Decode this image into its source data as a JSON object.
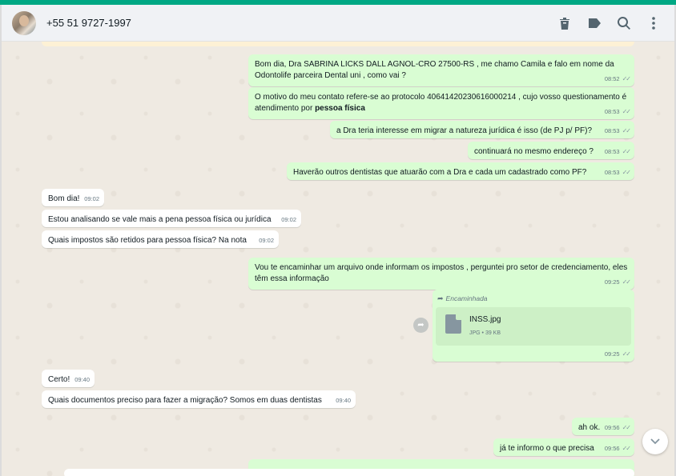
{
  "header": {
    "contact_name": "+55 51 9727-1997",
    "icons": [
      "trash-icon",
      "label-icon",
      "search-icon",
      "menu-icon"
    ]
  },
  "messages": [
    {
      "dir": "out",
      "text": "Bom dia, Dra  SABRINA LICKS DALL AGNOL-CRO  27500-RS , me chamo Camila e falo em nome da Odontolife parceira Dental uni , como vai ?",
      "time": "08:52"
    },
    {
      "dir": "out",
      "text": "O motivo do meu contato refere-se ao protocolo 40641420230616000214 , cujo vosso questionamento é atendimento por ",
      "bold": "pessoa física",
      "time": "08:53"
    },
    {
      "dir": "out",
      "text": "a Dra teria interesse em migrar a natureza jurídica é isso (de PJ p/ PF)?",
      "time": "08:53"
    },
    {
      "dir": "out",
      "text": "continuará no mesmo endereço ?",
      "time": "08:53"
    },
    {
      "dir": "out",
      "text": "Haverão outros dentistas que atuarão com a Dra e cada um cadastrado como PF?",
      "time": "08:53"
    },
    {
      "dir": "in",
      "text": "Bom dia!",
      "time": "09:02"
    },
    {
      "dir": "in",
      "text": "Estou analisando se vale mais a pena pessoa física ou jurídica",
      "time": "09:02"
    },
    {
      "dir": "in",
      "text": "Quais impostos são retidos para pessoa física? Na nota",
      "time": "09:02"
    },
    {
      "dir": "out",
      "text": "Vou te encaminhar um arquivo onde informam os impostos , perguntei pro setor de credenciamento, eles têm essa informação",
      "time": "09:25"
    },
    {
      "dir": "out",
      "forwarded": "Encaminhada",
      "file_name": "INSS.jpg",
      "file_info": "JPG • 39 KB",
      "time": "09:25"
    },
    {
      "dir": "in",
      "text": "Certo!",
      "time": "09:40"
    },
    {
      "dir": "in",
      "text": "Quais documentos preciso para fazer a migração? Somos em duas dentistas",
      "time": "09:40"
    },
    {
      "dir": "out",
      "text": "ah ok.",
      "time": "09:56"
    },
    {
      "dir": "out",
      "text": "já te informo o que precisa",
      "time": "09:56"
    }
  ]
}
